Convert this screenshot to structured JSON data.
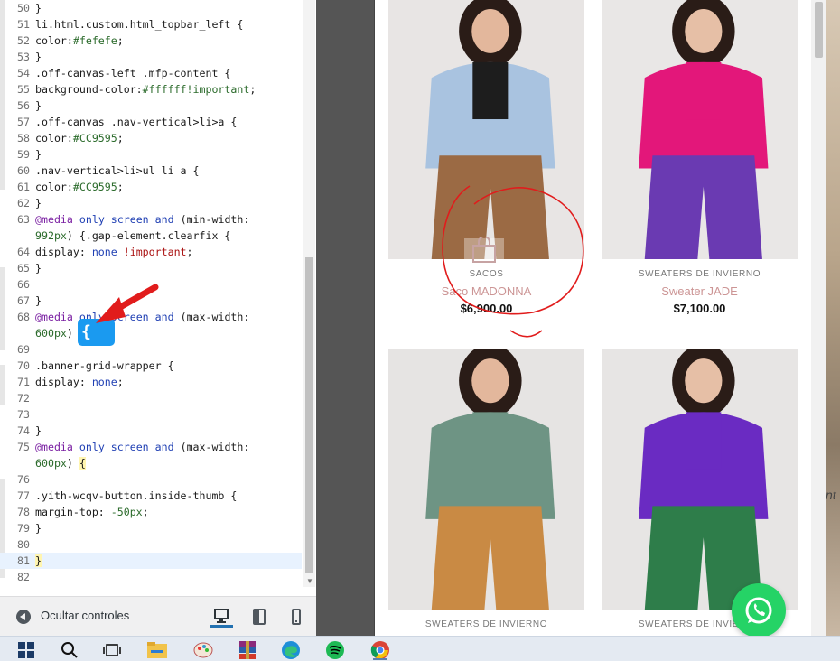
{
  "editor": {
    "lines": [
      {
        "n": "50",
        "segs": [
          {
            "t": "}"
          }
        ]
      },
      {
        "n": "51",
        "segs": [
          {
            "t": "li.html.custom.html_topbar_left {"
          }
        ]
      },
      {
        "n": "52",
        "segs": [
          {
            "t": "color:"
          },
          {
            "t": "#fefefe",
            "c": "tok-val"
          },
          {
            "t": ";"
          }
        ]
      },
      {
        "n": "53",
        "segs": [
          {
            "t": "}"
          }
        ]
      },
      {
        "n": "54",
        "segs": [
          {
            "t": ".off-canvas-left .mfp-content {"
          }
        ]
      },
      {
        "n": "55",
        "segs": [
          {
            "t": "background-color:"
          },
          {
            "t": "#ffffff!important",
            "c": "tok-val"
          },
          {
            "t": ";"
          }
        ]
      },
      {
        "n": "56",
        "segs": [
          {
            "t": "}"
          }
        ]
      },
      {
        "n": "57",
        "segs": [
          {
            "t": ".off-canvas .nav-vertical>li>a {"
          }
        ]
      },
      {
        "n": "58",
        "segs": [
          {
            "t": "color:"
          },
          {
            "t": "#CC9595",
            "c": "tok-val"
          },
          {
            "t": ";"
          }
        ]
      },
      {
        "n": "59",
        "segs": [
          {
            "t": "}"
          }
        ]
      },
      {
        "n": "60",
        "segs": [
          {
            "t": ".nav-vertical>li>ul li a {"
          }
        ]
      },
      {
        "n": "61",
        "segs": [
          {
            "t": "color:"
          },
          {
            "t": "#CC9595",
            "c": "tok-val"
          },
          {
            "t": ";"
          }
        ]
      },
      {
        "n": "62",
        "segs": [
          {
            "t": "}"
          }
        ]
      },
      {
        "n": "63",
        "segs": [
          {
            "t": "@media",
            "c": "tok-kw"
          },
          {
            "t": " "
          },
          {
            "t": "only",
            "c": "tok-kw2"
          },
          {
            "t": " "
          },
          {
            "t": "screen",
            "c": "tok-kw2"
          },
          {
            "t": " "
          },
          {
            "t": "and",
            "c": "tok-kw2"
          },
          {
            "t": " (min-width:"
          }
        ]
      },
      {
        "n": "",
        "segs": [
          {
            "t": "992px",
            "c": "tok-val"
          },
          {
            "t": ") {.gap-element.clearfix {"
          }
        ]
      },
      {
        "n": "64",
        "segs": [
          {
            "t": "display: "
          },
          {
            "t": "none",
            "c": "tok-kw2"
          },
          {
            "t": " "
          },
          {
            "t": "!important",
            "c": "tok-imp"
          },
          {
            "t": ";"
          }
        ]
      },
      {
        "n": "65",
        "segs": [
          {
            "t": "}"
          }
        ]
      },
      {
        "n": "66",
        "segs": [
          {
            "t": ""
          }
        ]
      },
      {
        "n": "67",
        "segs": [
          {
            "t": "}"
          }
        ]
      },
      {
        "n": "68",
        "segs": [
          {
            "t": "@media",
            "c": "tok-kw"
          },
          {
            "t": " "
          },
          {
            "t": "only",
            "c": "tok-kw2"
          },
          {
            "t": " "
          },
          {
            "t": "screen",
            "c": "tok-kw2"
          },
          {
            "t": " "
          },
          {
            "t": "and",
            "c": "tok-kw2"
          },
          {
            "t": " (max-width:"
          }
        ]
      },
      {
        "n": "",
        "segs": [
          {
            "t": "600px",
            "c": "tok-val"
          },
          {
            "t": ")"
          }
        ]
      },
      {
        "n": "69",
        "segs": [
          {
            "t": ""
          }
        ]
      },
      {
        "n": "70",
        "segs": [
          {
            "t": ".banner-grid-wrapper {"
          }
        ]
      },
      {
        "n": "71",
        "segs": [
          {
            "t": "display: "
          },
          {
            "t": "none",
            "c": "tok-kw2"
          },
          {
            "t": ";"
          }
        ]
      },
      {
        "n": "72",
        "segs": [
          {
            "t": ""
          }
        ]
      },
      {
        "n": "73",
        "segs": [
          {
            "t": ""
          }
        ]
      },
      {
        "n": "74",
        "segs": [
          {
            "t": "}"
          }
        ]
      },
      {
        "n": "75",
        "segs": [
          {
            "t": "@media",
            "c": "tok-kw"
          },
          {
            "t": " "
          },
          {
            "t": "only",
            "c": "tok-kw2"
          },
          {
            "t": " "
          },
          {
            "t": "screen",
            "c": "tok-kw2"
          },
          {
            "t": " "
          },
          {
            "t": "and",
            "c": "tok-kw2"
          },
          {
            "t": " (max-width:"
          }
        ]
      },
      {
        "n": "",
        "segs": [
          {
            "t": "600px",
            "c": "tok-val"
          },
          {
            "t": ") "
          },
          {
            "t": "{",
            "c": "tok-brace"
          }
        ]
      },
      {
        "n": "76",
        "segs": [
          {
            "t": ""
          }
        ]
      },
      {
        "n": "77",
        "segs": [
          {
            "t": ".yith-wcqv-button.inside-thumb {"
          }
        ]
      },
      {
        "n": "78",
        "segs": [
          {
            "t": "margin-top: "
          },
          {
            "t": "-50px",
            "c": "tok-val"
          },
          {
            "t": ";"
          }
        ]
      },
      {
        "n": "79",
        "segs": [
          {
            "t": "}"
          }
        ]
      },
      {
        "n": "80",
        "segs": [
          {
            "t": ""
          }
        ]
      },
      {
        "n": "81",
        "segs": [
          {
            "t": "}",
            "c": "tok-brace"
          }
        ],
        "active": true
      },
      {
        "n": "82",
        "segs": [
          {
            "t": ""
          }
        ]
      }
    ],
    "highlight_char": "{"
  },
  "controls": {
    "hide_label": "Ocultar controles",
    "devices": [
      "desktop-icon",
      "tablet-icon",
      "mobile-icon"
    ]
  },
  "products": [
    {
      "category": "SACOS",
      "name": "Saco MADONNA",
      "price": "$6,900.00",
      "palette": {
        "bg": "#e8e5e4",
        "top": "#a9c3e0",
        "under": "#1d1d1d",
        "bottom": "#9b6a44",
        "hair": "#2a1c17",
        "skin": "#e3b79c"
      }
    },
    {
      "category": "SWEATERS DE INVIERNO",
      "name": "Sweater JADE",
      "price": "$7,100.00",
      "palette": {
        "bg": "#e9e7e6",
        "top": "#e3177a",
        "under": "#e3177a",
        "bottom": "#6a3ab2",
        "hair": "#2a1c17",
        "skin": "#e6bfa6"
      }
    },
    {
      "category": "SWEATERS DE INVIERNO",
      "name": "",
      "price": "",
      "palette": {
        "bg": "#e6e4e3",
        "top": "#6e9484",
        "under": "#6e9484",
        "bottom": "#c98a44",
        "hair": "#2a1c17",
        "skin": "#e3b79c"
      }
    },
    {
      "category": "SWEATERS DE INVIERNO",
      "name": "",
      "price": "",
      "palette": {
        "bg": "#e7e5e4",
        "top": "#6a2bc2",
        "under": "#6a2bc2",
        "bottom": "#2e7d4a",
        "hair": "#2a1c17",
        "skin": "#e6bfa6"
      }
    }
  ],
  "desktop_text": "nt",
  "taskbar": {
    "icons": [
      "windows-start-icon",
      "search-icon",
      "task-view-icon",
      "file-explorer-icon",
      "paint-icon",
      "winrar-icon",
      "edge-icon",
      "spotify-icon",
      "chrome-icon"
    ]
  },
  "colors": {
    "accent": "#cc9595",
    "whatsapp": "#25d366",
    "annotation_red": "#e11c1c",
    "highlight_blue": "#1a9af0"
  }
}
